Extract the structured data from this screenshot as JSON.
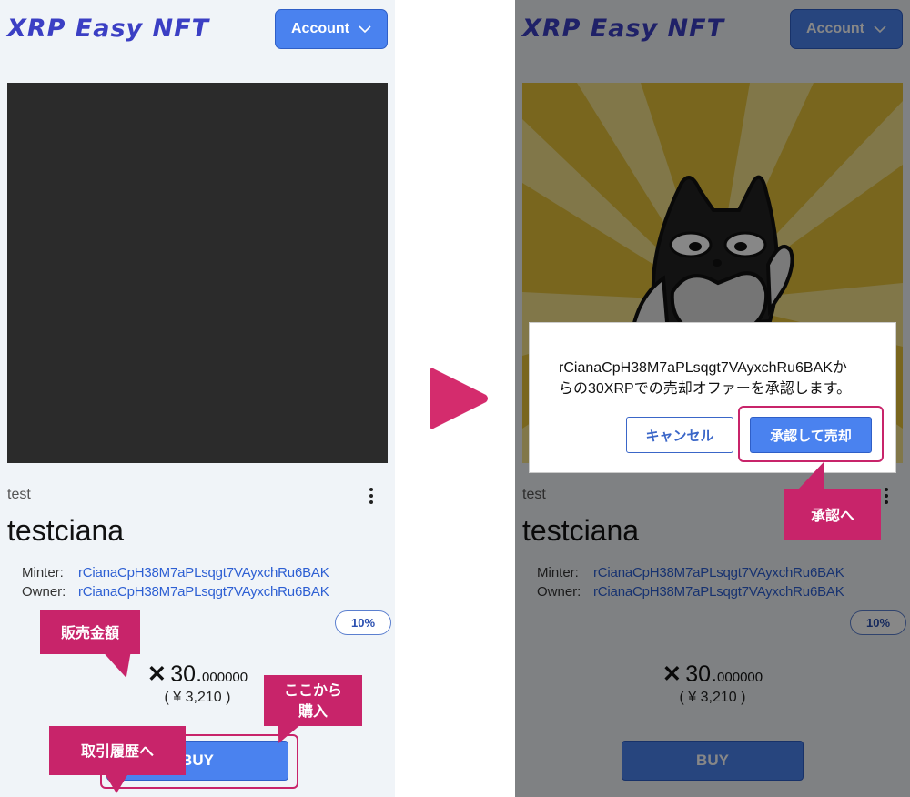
{
  "app": {
    "logo": "XRP Easy NFT",
    "account_label": "Account"
  },
  "nft": {
    "collection": "test",
    "name": "testciana",
    "minter_label": "Minter:",
    "minter_address": "rCianaCpH38M7aPLsqgt7VAyxchRu6BAK",
    "owner_label": "Owner:",
    "owner_address": "rCianaCpH38M7aPLsqgt7VAyxchRu6BAK",
    "royalty": "10%",
    "price_symbol": "✕",
    "price_int": "30.",
    "price_decimals": "000000",
    "price_yen": "( ¥ 3,210 )",
    "buy_label": "BUY"
  },
  "dialog": {
    "message_line1": "rCianaCpH38M7aPLsqgt7VAyxchRu6BAKか",
    "message_line2": "らの30XRPでの売却オファーを承認します。",
    "cancel_label": "キャンセル",
    "approve_label": "承認して売却"
  },
  "callouts": {
    "sale_price": "販売金額",
    "buy_here_line1": "ここから",
    "buy_here_line2": "購入",
    "history": "取引履歴へ",
    "approve": "承認へ"
  },
  "colors": {
    "accent": "#4a82ef",
    "callout": "#c8246a",
    "logo": "#3b3fc4",
    "link": "#2d5fd3"
  }
}
